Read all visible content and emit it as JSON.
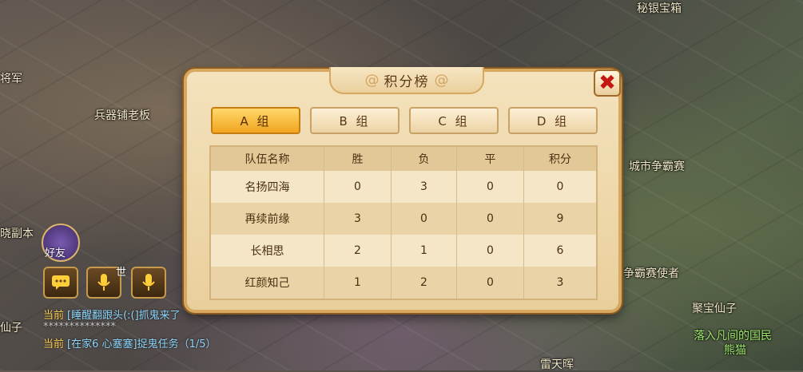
{
  "world": {
    "labels": {
      "treasure": "秘银宝箱",
      "general": "将军",
      "weapon_shop": "兵器铺老板",
      "city_contest": "城市争霸赛",
      "contest_envoy": "争霸赛使者",
      "treasure_fairy": "聚宝仙子",
      "dawn_dungeon": "晓副本",
      "fairy_left": "仙子",
      "bottom_center": "雷天晖",
      "bottom_right": "落入凡间的国民",
      "bottom_right_sub": "熊猫"
    },
    "friend_label": "好友",
    "voice_world_label": "世"
  },
  "chat": [
    {
      "tag": "当前",
      "text": "[睡醒翻跟头(:(]抓鬼来了"
    },
    {
      "tag": "",
      "text": "**************"
    },
    {
      "tag": "当前",
      "text": "[在家6 心塞塞]捉鬼任务（1/5）"
    }
  ],
  "panel": {
    "title": "积分榜",
    "close_symbol": "✖",
    "tabs": [
      {
        "label": "A 组",
        "active": true
      },
      {
        "label": "B 组",
        "active": false
      },
      {
        "label": "C 组",
        "active": false
      },
      {
        "label": "D 组",
        "active": false
      }
    ],
    "columns": [
      "队伍名称",
      "胜",
      "负",
      "平",
      "积分"
    ],
    "rows": [
      [
        "名扬四海",
        "0",
        "3",
        "0",
        "0"
      ],
      [
        "再续前缘",
        "3",
        "0",
        "0",
        "9"
      ],
      [
        "长相思",
        "2",
        "1",
        "0",
        "6"
      ],
      [
        "红颜知己",
        "1",
        "2",
        "0",
        "3"
      ]
    ]
  },
  "colors": {
    "active_tab": "#f1a51f",
    "close_x": "#c21a12",
    "panel_bg": "#f4e2bc"
  }
}
